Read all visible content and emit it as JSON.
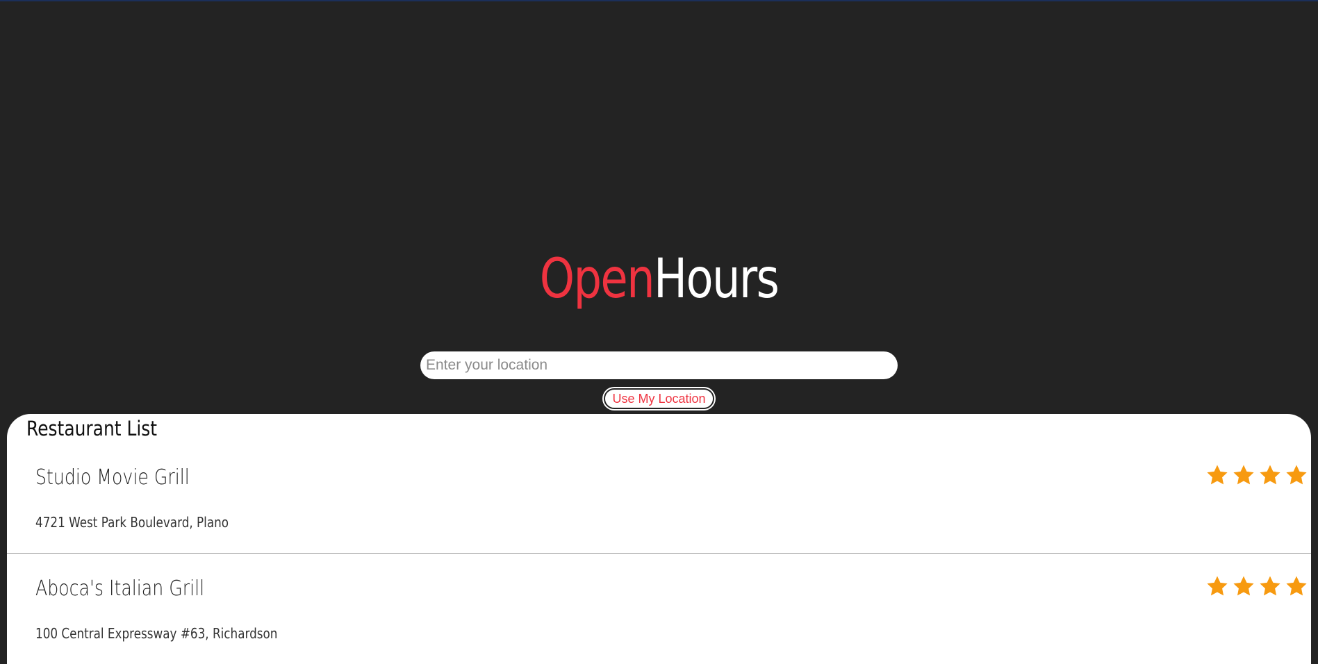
{
  "brand": {
    "open": "Open",
    "hours": "Hours",
    "open_color": "#ef3340",
    "hours_color": "#ffffff"
  },
  "search": {
    "placeholder": "Enter your location",
    "value": ""
  },
  "locate_button": {
    "label": "Use My Location"
  },
  "restaurant_list": {
    "title": "Restaurant List",
    "star_color": "#f79a10",
    "items": [
      {
        "name": "Studio Movie Grill",
        "address": "4721 West Park Boulevard, Plano",
        "rating": 4
      },
      {
        "name": "Aboca's Italian Grill",
        "address": "100 Central Expressway #63, Richardson",
        "rating": 4
      }
    ]
  }
}
